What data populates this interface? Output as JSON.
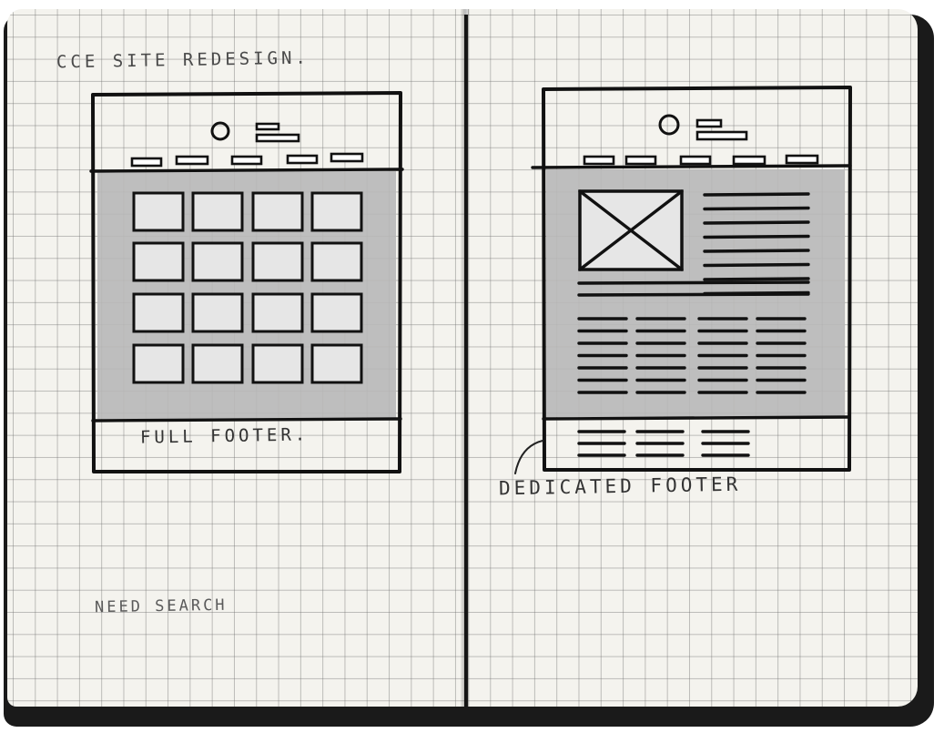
{
  "notebook": {
    "left_page": {
      "title_note": "CCE SITE REDESIGN.",
      "footer_label": "FULL FOOTER.",
      "bottom_note": "NEED SEARCH"
    },
    "right_page": {
      "footer_label": "DEDICATED FOOTER"
    }
  },
  "colors": {
    "paper": "#f4f3ee",
    "grid": "#6e6e6e",
    "ink": "#111111",
    "shading": "#b8b8b8",
    "cover": "#1a1a1a"
  },
  "sketches": {
    "left": {
      "nav_items": 5,
      "grid_rows": 4,
      "grid_cols": 4
    },
    "right": {
      "nav_items": 5,
      "text_columns": 4,
      "footer_columns": 3
    }
  }
}
